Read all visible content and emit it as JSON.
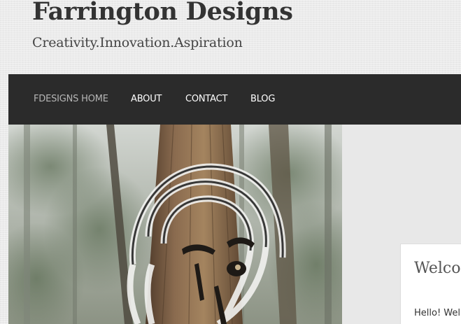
{
  "site": {
    "title": "Farrington Designs",
    "tagline": "Creativity.Innovation.Aspiration"
  },
  "nav": {
    "items": [
      {
        "label": "FDESIGNS HOME",
        "active": true
      },
      {
        "label": "ABOUT",
        "active": false
      },
      {
        "label": "CONTACT",
        "active": false
      },
      {
        "label": "BLOG",
        "active": false
      }
    ]
  },
  "hero": {
    "description": "Foggy redwood forest photo with a swirling face drawing overlaid on a tree trunk"
  },
  "welcome": {
    "title": "Welco",
    "text": "Hello! Wel"
  },
  "colors": {
    "nav_background": "#2b2b2b",
    "nav_text": "#ffffff",
    "nav_active_text": "#b5b5b5",
    "title_text": "#333333",
    "page_background": "#ebebeb"
  }
}
